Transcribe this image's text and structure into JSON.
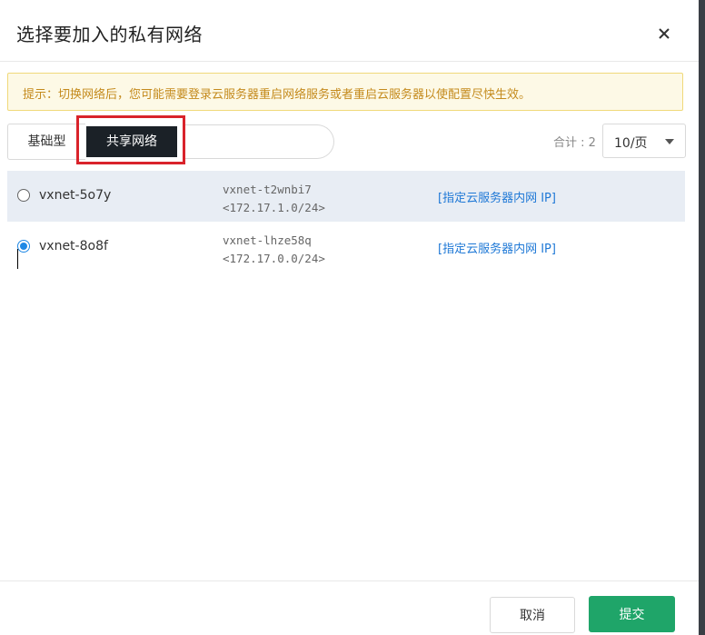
{
  "dialog": {
    "title": "选择要加入的私有网络",
    "notice": "提示：切换网络后，您可能需要登录云服务器重启网络服务或者重启云服务器以使配置尽快生效。",
    "tabs": [
      {
        "label": "基础型",
        "active": false
      },
      {
        "label": "共享网络",
        "active": true
      }
    ],
    "search": {
      "value": "",
      "placeholder": ""
    },
    "pagination": {
      "total_label": "合计 : 2",
      "page_size": "10/页"
    },
    "rows": [
      {
        "name": "vxnet-5o7y",
        "id": "vxnet-t2wnbi7",
        "cidr": "<172.17.1.0/24>",
        "link": "[指定云服务器内网 IP]",
        "checked": false
      },
      {
        "name": "vxnet-8o8f",
        "id": "vxnet-lhze58q",
        "cidr": "<172.17.0.0/24>",
        "link": "[指定云服务器内网 IP]",
        "checked": true
      }
    ],
    "buttons": {
      "cancel": "取消",
      "submit": "提交"
    }
  },
  "colors": {
    "accent_blue": "#1e88e5",
    "submit_green": "#1fa569",
    "notice_text": "#c48a1c",
    "highlight_red": "#d9232b",
    "active_tab": "#1b2127"
  },
  "icons": {
    "close": "close-icon",
    "dropdown": "chevron-down-icon"
  }
}
